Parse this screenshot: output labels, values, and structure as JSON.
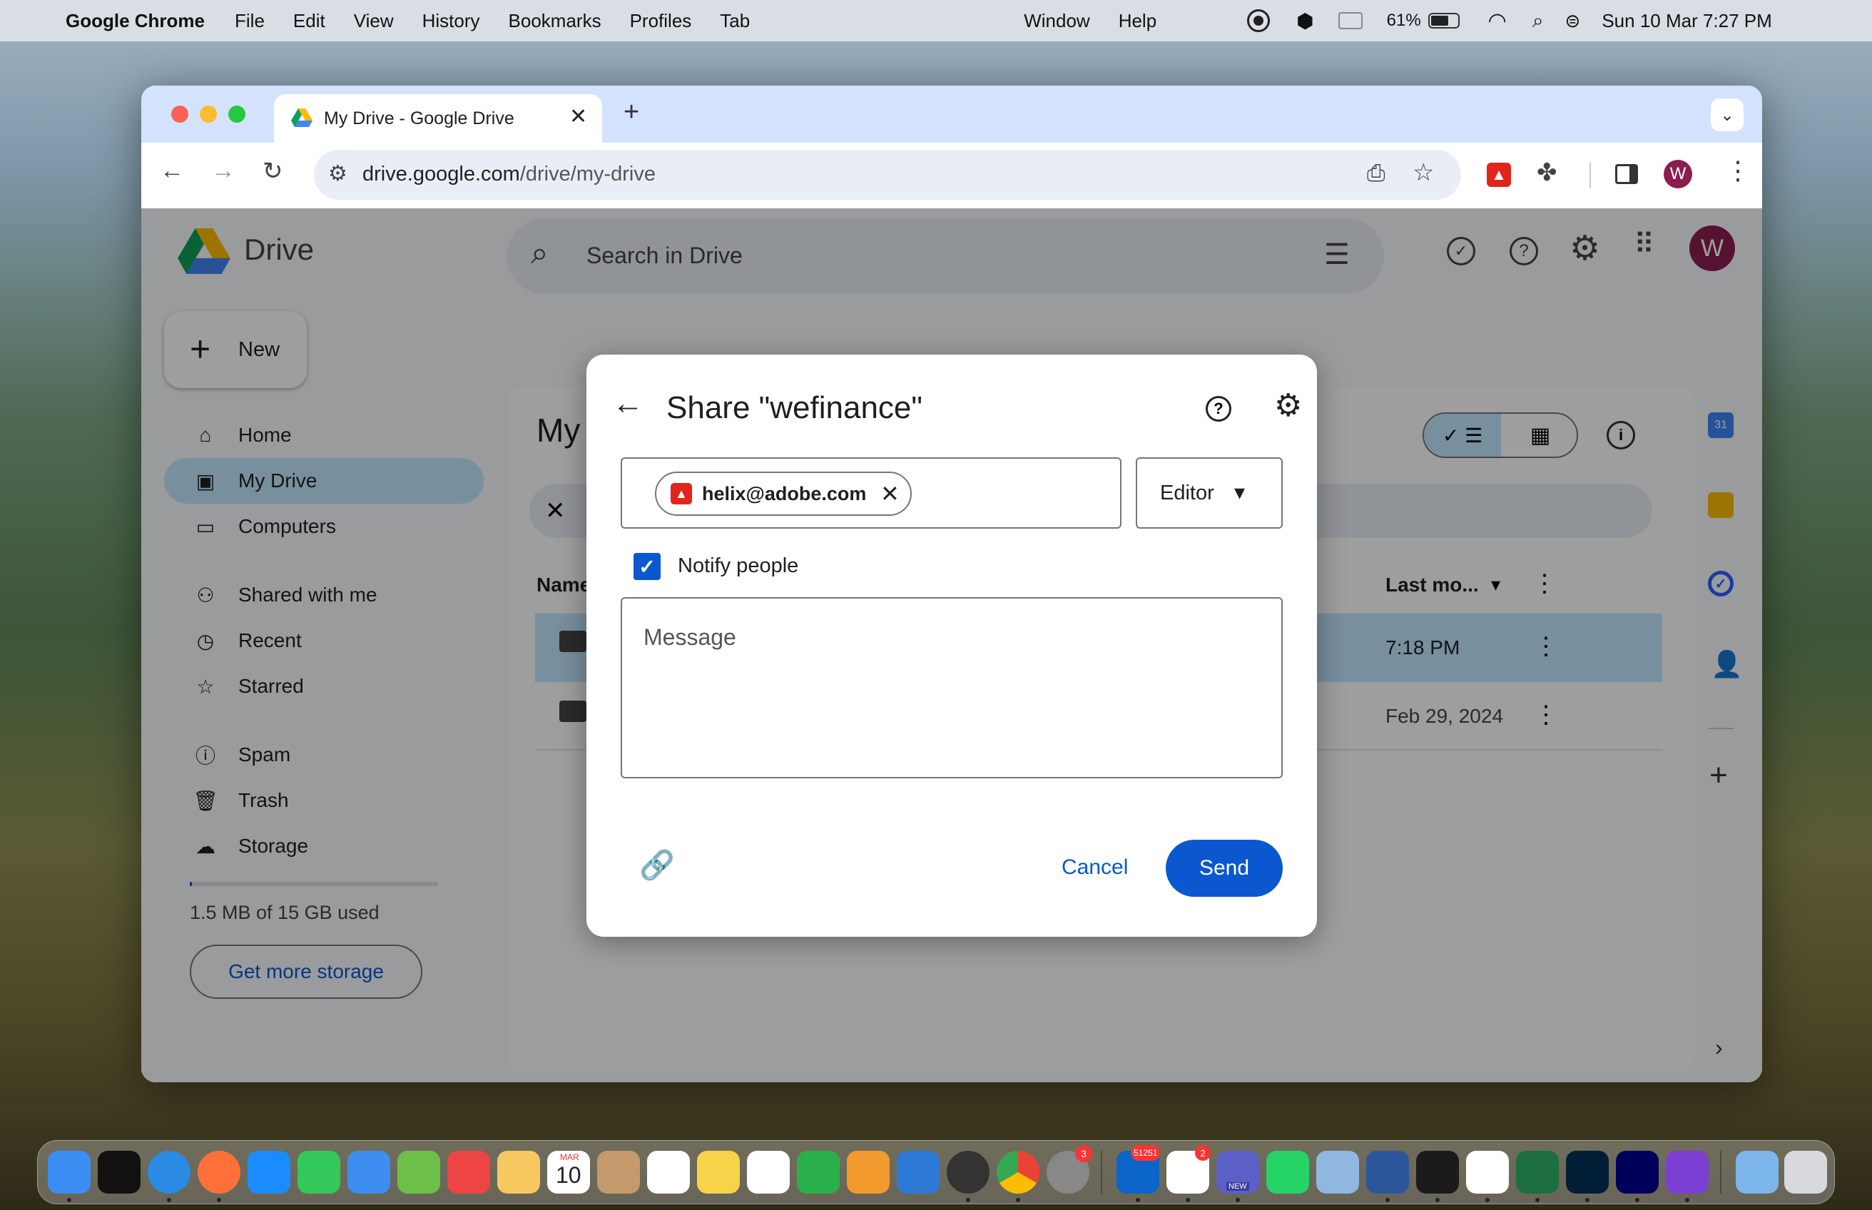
{
  "menubar": {
    "app_name": "Google Chrome",
    "items": [
      "File",
      "Edit",
      "View",
      "History",
      "Bookmarks",
      "Profiles",
      "Tab",
      "Window",
      "Help"
    ],
    "battery": "61%",
    "clock": "Sun 10 Mar  7:27 PM"
  },
  "browser": {
    "tab_title": "My Drive - Google Drive",
    "url_domain": "drive.google.com",
    "url_path": "/drive/my-drive",
    "profile_initial": "W"
  },
  "drive": {
    "logo_text": "Drive",
    "search_placeholder": "Search in Drive",
    "avatar_initial": "W",
    "new_button": "New",
    "nav": [
      "Home",
      "My Drive",
      "Computers",
      "Shared with me",
      "Recent",
      "Starred",
      "Spam",
      "Trash",
      "Storage"
    ],
    "storage_used": "1.5 MB of 15 GB used",
    "storage_fraction": 0.0001,
    "get_storage": "Get more storage",
    "page_title": "My Drive",
    "col_name": "Name",
    "col_modified": "Last mo...",
    "rows": [
      {
        "modified": "7:18 PM"
      },
      {
        "modified": "Feb 29, 2024"
      }
    ]
  },
  "dialog": {
    "title": "Share \"wefinance\"",
    "chip_email": "helix@adobe.com",
    "role": "Editor",
    "notify_label": "Notify people",
    "notify_checked": true,
    "message_placeholder": "Message",
    "cancel": "Cancel",
    "send": "Send"
  },
  "dock": {
    "calendar_month": "MAR",
    "calendar_day": "10",
    "outlook_badge": "51251",
    "slack_badge": "2",
    "settings_badge": "3",
    "teams_label": "NEW"
  },
  "colors": {
    "accent": "#0b57d0",
    "selected": "#c2e7ff",
    "send_bg": "#0b57d0",
    "avatar": "#8c1d4f"
  }
}
